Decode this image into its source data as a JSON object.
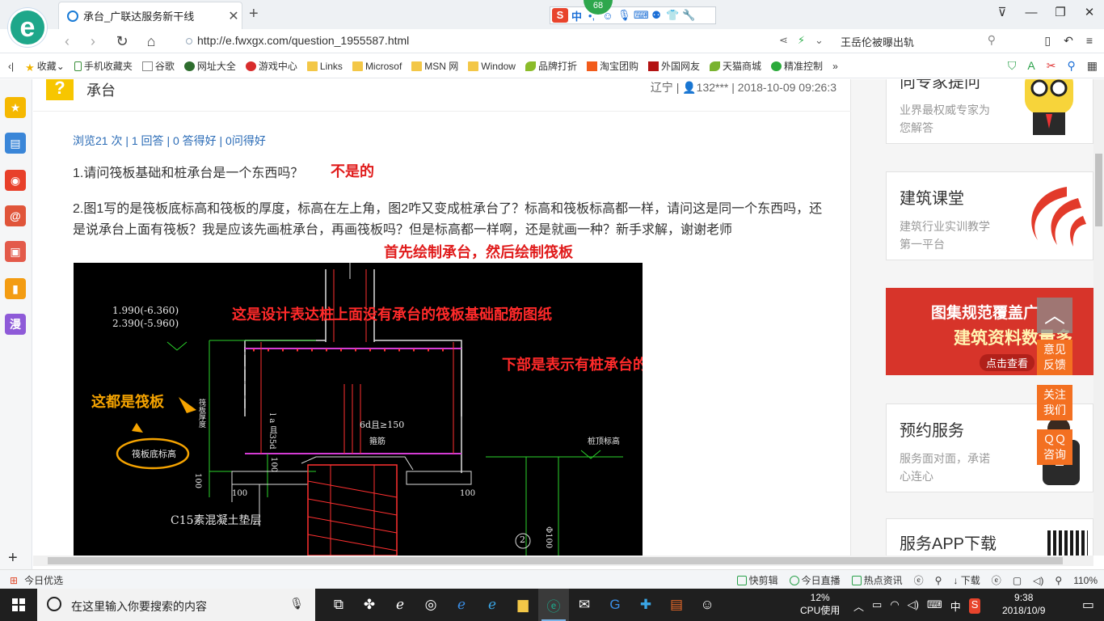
{
  "browser": {
    "logo_letter": "e",
    "tab_title": "承台_广联达服务新干线",
    "tab_close": "✕",
    "new_tab": "+",
    "ime": {
      "badge": "68",
      "s": "S",
      "zh": "中"
    },
    "window_controls": [
      "⊽",
      "—",
      "❐",
      "✕"
    ]
  },
  "address": {
    "url": "http://e.fwxgx.com/question_1955587.html",
    "news_search": "王岳伦被曝出轨"
  },
  "bookmarks": [
    {
      "label": "收藏",
      "icon": "star-icon"
    },
    {
      "label": "手机收藏夹",
      "icon": "phone-icon"
    },
    {
      "label": "谷歌",
      "icon": "page-icon"
    },
    {
      "label": "网址大全",
      "icon": "globe-icon"
    },
    {
      "label": "游戏中心",
      "icon": "game-icon"
    },
    {
      "label": "Links",
      "icon": "folder-icon"
    },
    {
      "label": "Microsof",
      "icon": "folder-icon"
    },
    {
      "label": "MSN 网",
      "icon": "folder-icon"
    },
    {
      "label": "Window",
      "icon": "folder-icon"
    },
    {
      "label": "品牌打折",
      "icon": "leaf-icon"
    },
    {
      "label": "淘宝团购",
      "icon": "taobao-icon"
    },
    {
      "label": "外国网友",
      "icon": "wai-icon"
    },
    {
      "label": "天猫商城",
      "icon": "tmall-icon"
    },
    {
      "label": "精准控制",
      "icon": "chat-icon"
    }
  ],
  "question": {
    "title": "承台",
    "meta": "辽宁 | 👤132*** | 2018-10-09 09:26:3",
    "stats": "浏览21 次 | 1 回答 | 0 答得好 | 0问得好",
    "line1": "1.请问筏板基础和桩承台是一个东西吗？",
    "line2": "2.图1写的是筏板底标高和筏板的厚度，标高在左上角，图2咋又变成桩承台了？标高和筏板标高都一样，请问这是同一个东西吗，还是说承台上面有筏板？我是应该先画桩承台，再画筏板吗？但是标高都一样啊，还是就画一种？新手求解，谢谢老师",
    "ann_not_same": "不是的",
    "ann_first": "首先绘制承台，然后绘制筏板"
  },
  "cad": {
    "level1": "1.990(-6.360)",
    "level2": "2.390(-5.960)",
    "ann_design": "这是设计表达桩上面没有承台的筏板基础配筋图纸",
    "ann_lower": "下部是表示有桩承台的基础",
    "ann_raft": "这都是筏板",
    "raft_bottom_label": "筏板底标高",
    "raft_thk_label": "筏板厚度",
    "l_label": "l a 且35d",
    "d6_label": "6d且≥150",
    "hoop_label": "箍筋",
    "pile_top_label": "桩顶标高",
    "dim_100": "100",
    "c15_label": "C15素混凝土垫层",
    "c100": "Φ100",
    "side_num": "2"
  },
  "sidebar": {
    "expert": {
      "title": "向专家提问",
      "sub": "业界最权威专家为您解答"
    },
    "course": {
      "title": "建筑课堂",
      "sub": "建筑行业实训教学第一平台"
    },
    "banner": {
      "line1": "图集规范覆盖广",
      "line2": "建筑资料数量多",
      "cta": "点击查看"
    },
    "booking": {
      "title": "预约服务",
      "sub": "服务面对面，承诺心连心"
    },
    "app": {
      "title": "服务APP下载"
    }
  },
  "float": {
    "top": "︿",
    "feedback": "意见\n反馈",
    "follow": "关注\n我们",
    "qq": "ＱＱ\n咨询"
  },
  "status": {
    "left": "今日优选",
    "items": [
      "快剪辑",
      "今日直播",
      "热点资讯",
      "下载",
      "110%"
    ]
  },
  "taskbar": {
    "search_placeholder": "在这里输入你要搜索的内容",
    "cpu": "12%",
    "cpu_label": "CPU使用",
    "ime": "中",
    "time": "9:38",
    "date": "2018/10/9"
  },
  "colors": {
    "accent_green": "#1ea78a",
    "link_blue": "#2a6bb6",
    "annotation_red": "#e01b1b",
    "float_orange": "#f37021"
  }
}
